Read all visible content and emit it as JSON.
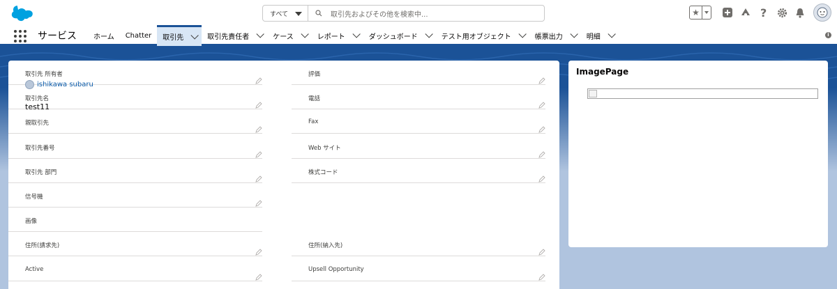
{
  "search": {
    "scope": "すべて",
    "placeholder": "取引先およびその他を検索中..."
  },
  "app": {
    "name": "サービス"
  },
  "nav": {
    "tabs": [
      {
        "label": "ホーム",
        "dropdown": false
      },
      {
        "label": "Chatter",
        "dropdown": false
      },
      {
        "label": "取引先",
        "dropdown": true,
        "active": true
      },
      {
        "label": "取引先責任者",
        "dropdown": true
      },
      {
        "label": "ケース",
        "dropdown": true
      },
      {
        "label": "レポート",
        "dropdown": true
      },
      {
        "label": "ダッシュボード",
        "dropdown": true
      },
      {
        "label": "テスト用オブジェクト",
        "dropdown": true
      },
      {
        "label": "帳票出力",
        "dropdown": true
      },
      {
        "label": "明細",
        "dropdown": true
      }
    ]
  },
  "record": {
    "left": [
      {
        "label": "取引先 所有者",
        "value": "ishikawa subaru",
        "type": "owner"
      },
      {
        "label": "取引先名",
        "value": "test11"
      },
      {
        "label": "親取引先",
        "value": ""
      },
      {
        "label": "取引先番号",
        "value": ""
      },
      {
        "label": "取引先 部門",
        "value": ""
      },
      {
        "label": "信号機",
        "value": ""
      },
      {
        "label": "画像",
        "value": "",
        "noedit": true
      },
      {
        "label": "住所(請求先)",
        "value": ""
      },
      {
        "label": "Active",
        "value": ""
      }
    ],
    "right": [
      {
        "label": "評価",
        "value": ""
      },
      {
        "label": "電話",
        "value": ""
      },
      {
        "label": "Fax",
        "value": ""
      },
      {
        "label": "Web サイト",
        "value": ""
      },
      {
        "label": "株式コード",
        "value": ""
      },
      {
        "label": "",
        "value": "",
        "empty": true
      },
      {
        "label": "",
        "value": "",
        "empty": true
      },
      {
        "label": "住所(納入先)",
        "value": ""
      },
      {
        "label": "Upsell Opportunity",
        "value": ""
      }
    ]
  },
  "side": {
    "title": "ImagePage"
  },
  "colors": {
    "brand": "#1b5297",
    "link": "#0b5cab",
    "active_tab": "#d8e6f5"
  }
}
